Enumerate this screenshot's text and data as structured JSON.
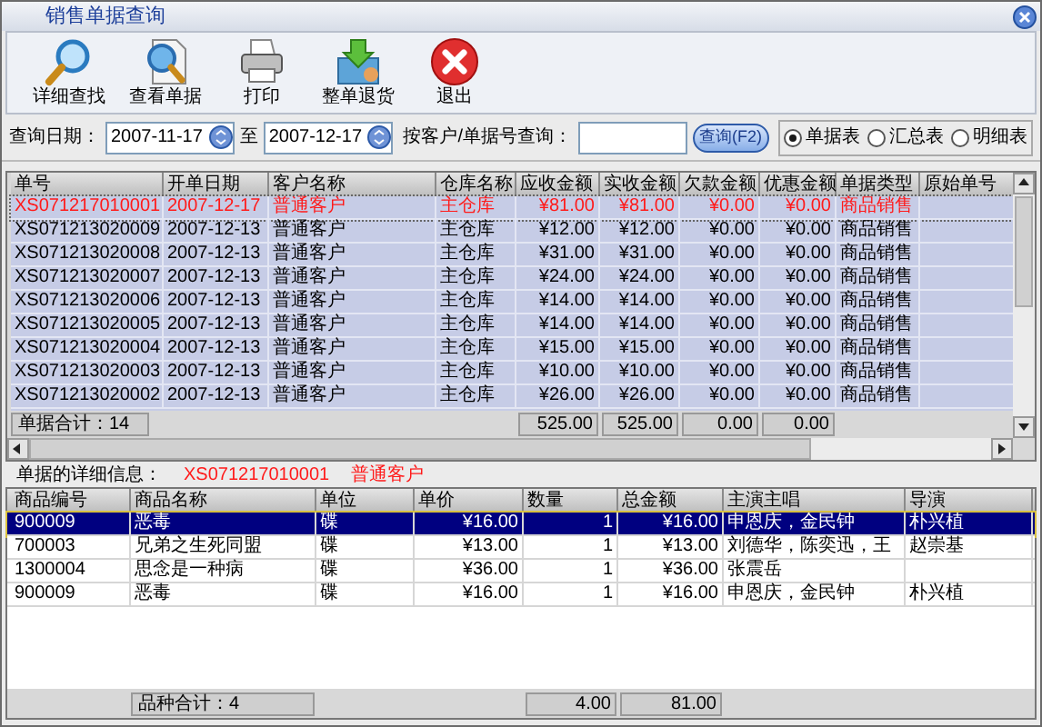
{
  "window": {
    "title": "销售单据查询"
  },
  "toolbar": [
    {
      "kind": "find",
      "label": "详细查找"
    },
    {
      "kind": "view",
      "label": "查看单据"
    },
    {
      "kind": "print",
      "label": "打印"
    },
    {
      "kind": "return",
      "label": "整单退货"
    },
    {
      "kind": "exit",
      "label": "退出"
    }
  ],
  "query": {
    "date_label": "查询日期：",
    "from": "2007-11-17",
    "to_label": "至",
    "to": "2007-12-17",
    "search_label": "按客户/单据号查询：",
    "search_button": "查询(F2)"
  },
  "views": [
    {
      "label": "单据表",
      "selected": true
    },
    {
      "label": "汇总表",
      "selected": false
    },
    {
      "label": "明细表",
      "selected": false
    }
  ],
  "orders": {
    "columns": [
      "单号",
      "开单日期",
      "客户名称",
      "仓库名称",
      "应收金额",
      "实收金额",
      "欠款金额",
      "优惠金额",
      "单据类型",
      "原始单号"
    ],
    "rows": [
      {
        "selected": true,
        "cells": [
          "XS071217010001",
          "2007-12-17",
          "普通客户",
          "主仓库",
          "¥81.00",
          "¥81.00",
          "¥0.00",
          "¥0.00",
          "商品销售",
          ""
        ]
      },
      {
        "selected": false,
        "cells": [
          "XS071213020009",
          "2007-12-13",
          "普通客户",
          "主仓库",
          "¥12.00",
          "¥12.00",
          "¥0.00",
          "¥0.00",
          "商品销售",
          ""
        ]
      },
      {
        "selected": false,
        "cells": [
          "XS071213020008",
          "2007-12-13",
          "普通客户",
          "主仓库",
          "¥31.00",
          "¥31.00",
          "¥0.00",
          "¥0.00",
          "商品销售",
          ""
        ]
      },
      {
        "selected": false,
        "cells": [
          "XS071213020007",
          "2007-12-13",
          "普通客户",
          "主仓库",
          "¥24.00",
          "¥24.00",
          "¥0.00",
          "¥0.00",
          "商品销售",
          ""
        ]
      },
      {
        "selected": false,
        "cells": [
          "XS071213020006",
          "2007-12-13",
          "普通客户",
          "主仓库",
          "¥14.00",
          "¥14.00",
          "¥0.00",
          "¥0.00",
          "商品销售",
          ""
        ]
      },
      {
        "selected": false,
        "cells": [
          "XS071213020005",
          "2007-12-13",
          "普通客户",
          "主仓库",
          "¥14.00",
          "¥14.00",
          "¥0.00",
          "¥0.00",
          "商品销售",
          ""
        ]
      },
      {
        "selected": false,
        "cells": [
          "XS071213020004",
          "2007-12-13",
          "普通客户",
          "主仓库",
          "¥15.00",
          "¥15.00",
          "¥0.00",
          "¥0.00",
          "商品销售",
          ""
        ]
      },
      {
        "selected": false,
        "cells": [
          "XS071213020003",
          "2007-12-13",
          "普通客户",
          "主仓库",
          "¥10.00",
          "¥10.00",
          "¥0.00",
          "¥0.00",
          "商品销售",
          ""
        ]
      },
      {
        "selected": false,
        "cells": [
          "XS071213020002",
          "2007-12-13",
          "普通客户",
          "主仓库",
          "¥26.00",
          "¥26.00",
          "¥0.00",
          "¥0.00",
          "商品销售",
          ""
        ]
      }
    ],
    "footer": {
      "count": "单据合计：14",
      "totals": [
        "525.00",
        "525.00",
        "0.00",
        "0.00"
      ]
    }
  },
  "detail": {
    "label": "单据的详细信息：",
    "order_no": "XS071217010001",
    "customer": "普通客户",
    "columns": [
      "商品编号",
      "商品名称",
      "单位",
      "单价",
      "数量",
      "总金额",
      "主演主唱",
      "导演"
    ],
    "rows": [
      {
        "selected": true,
        "cells": [
          "900009",
          "恶毒",
          "碟",
          "¥16.00",
          "1",
          "¥16.00",
          "申恩庆，金民钟",
          "朴兴植"
        ]
      },
      {
        "selected": false,
        "cells": [
          "700003",
          "兄弟之生死同盟",
          "碟",
          "¥13.00",
          "1",
          "¥13.00",
          "刘德华，陈奕迅，王",
          "赵崇基"
        ]
      },
      {
        "selected": false,
        "cells": [
          "1300004",
          "思念是一种病",
          "碟",
          "¥36.00",
          "1",
          "¥36.00",
          "张震岳",
          ""
        ]
      },
      {
        "selected": false,
        "cells": [
          "900009",
          "恶毒",
          "碟",
          "¥16.00",
          "1",
          "¥16.00",
          "申恩庆，金民钟",
          "朴兴植"
        ]
      }
    ],
    "footer": {
      "count": "品种合计：4",
      "quantity": "4.00",
      "total": "81.00"
    }
  }
}
